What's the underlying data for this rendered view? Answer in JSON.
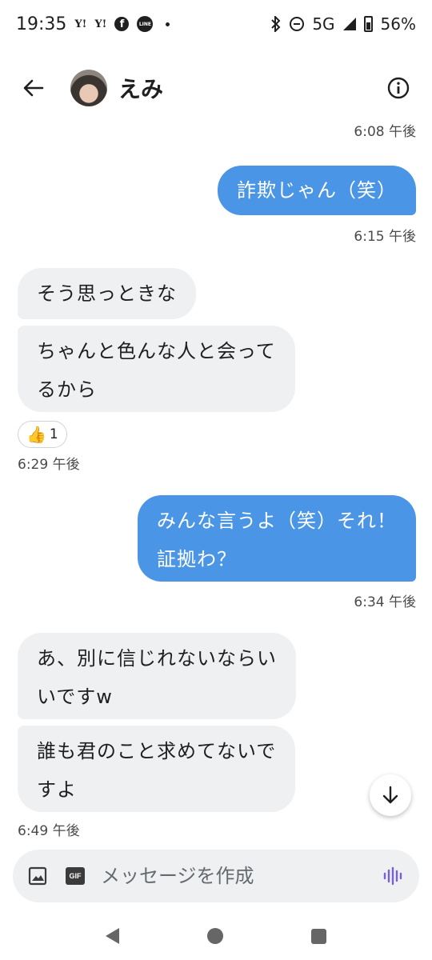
{
  "status_bar": {
    "time": "19:35",
    "notification_icons": [
      "Y!",
      "Y!",
      "f",
      "LINE"
    ],
    "network": "5G",
    "battery": "56%"
  },
  "header": {
    "contact_name": "えみ"
  },
  "messages": [
    {
      "type": "timestamp",
      "side": "right",
      "text": "6:08 午後"
    },
    {
      "type": "outgoing",
      "lines": [
        "詐欺じゃん（笑）"
      ]
    },
    {
      "type": "timestamp",
      "side": "right",
      "text": "6:15 午後"
    },
    {
      "type": "incoming",
      "lines": [
        "そう思っときな"
      ]
    },
    {
      "type": "incoming",
      "lines": [
        "ちゃんと色んな人と会って",
        "るから"
      ]
    },
    {
      "type": "reaction",
      "emoji": "👍",
      "count": "1"
    },
    {
      "type": "timestamp",
      "side": "left",
      "text": "6:29 午後"
    },
    {
      "type": "outgoing",
      "lines": [
        "みんな言うよ（笑）それ！",
        "証拠わ？"
      ]
    },
    {
      "type": "timestamp",
      "side": "right",
      "text": "6:34 午後"
    },
    {
      "type": "incoming",
      "lines": [
        "あ、別に信じれないならい",
        "いですw"
      ]
    },
    {
      "type": "incoming",
      "lines": [
        "誰も君のこと求めてないで",
        "すよ"
      ]
    },
    {
      "type": "timestamp",
      "side": "left",
      "text": "6:49 午後"
    }
  ],
  "compose": {
    "placeholder": "メッセージを作成",
    "gif_label": "GIF"
  },
  "colors": {
    "outgoing_bubble": "#4a95e6",
    "incoming_bubble": "#eef0f2",
    "voice_accent": "#7b5fd6"
  }
}
